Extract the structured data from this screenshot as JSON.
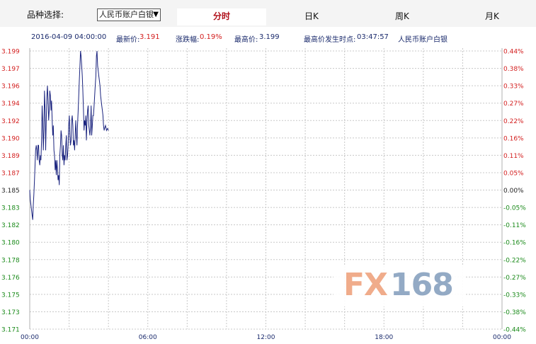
{
  "header": {
    "selector_label": "品种选择:",
    "selected_product": "人民币账户白银",
    "tabs": [
      "分时",
      "日K",
      "周K",
      "月K"
    ],
    "active_tab": "分时"
  },
  "info": {
    "datetime": "2016-04-09 04:00:00",
    "latest_label": "最新价:",
    "latest_value": "3.191",
    "change_label": "涨跌幅:",
    "change_value": "0.19%",
    "high_label": "最高价:",
    "high_value": "3.199",
    "high_time_label": "最高价发生时点:",
    "high_time_value": "03:47:57",
    "product_name": "人民币账户白银"
  },
  "watermark": {
    "part1": "FX",
    "part2": "168"
  },
  "colors": {
    "up": "#d31e1e",
    "down": "#1a8a1a",
    "neutral": "#222222",
    "line": "#1a237e",
    "time": "#1a2a6c"
  },
  "chart_data": {
    "type": "line",
    "y_left_ticks": [
      "3.199",
      "3.197",
      "3.196",
      "3.194",
      "3.192",
      "3.190",
      "3.189",
      "3.187",
      "3.185",
      "3.183",
      "3.182",
      "3.180",
      "3.178",
      "3.176",
      "3.175",
      "3.173",
      "3.171"
    ],
    "y_right_ticks": [
      "0.44%",
      "0.38%",
      "0.33%",
      "0.27%",
      "0.22%",
      "0.16%",
      "0.11%",
      "0.05%",
      "0.00%",
      "-0.05%",
      "-0.11%",
      "-0.16%",
      "-0.22%",
      "-0.27%",
      "-0.33%",
      "-0.38%",
      "-0.44%"
    ],
    "x_ticks": [
      "00:00",
      "06:00",
      "12:00",
      "18:00",
      "00:00"
    ],
    "ylim": [
      3.171,
      3.199
    ],
    "xlim_hours": [
      0,
      24
    ],
    "reference_price": 3.185,
    "series": [
      {
        "x": [
          0,
          0.03,
          0.06,
          0.09,
          0.12,
          0.15,
          0.18,
          0.21,
          0.24,
          0.27,
          0.3,
          0.33,
          0.36,
          0.39,
          0.42,
          0.45,
          0.48,
          0.51,
          0.54,
          0.57,
          0.6,
          0.63,
          0.66,
          0.69,
          0.72,
          0.75,
          0.78,
          0.81,
          0.84,
          0.87,
          0.9,
          0.93,
          0.96,
          0.99,
          1.02,
          1.05,
          1.08,
          1.11,
          1.14,
          1.17,
          1.2,
          1.23,
          1.26,
          1.29,
          1.32,
          1.35,
          1.38,
          1.41,
          1.44,
          1.47,
          1.5,
          1.53,
          1.56,
          1.59,
          1.62,
          1.65,
          1.68,
          1.71,
          1.74,
          1.77,
          1.8,
          1.83,
          1.86,
          1.89,
          1.92,
          1.95,
          1.98,
          2.01,
          2.04,
          2.07,
          2.1,
          2.13,
          2.16,
          2.19,
          2.22,
          2.25,
          2.28,
          2.31,
          2.34,
          2.37,
          2.4,
          2.43,
          2.46,
          2.49,
          2.52,
          2.55,
          2.58,
          2.61,
          2.64,
          2.67,
          2.7,
          2.73,
          2.76,
          2.79,
          2.82,
          2.85,
          2.88,
          2.91,
          2.94,
          2.97,
          3.0,
          3.03,
          3.06,
          3.09,
          3.12,
          3.15,
          3.18,
          3.21,
          3.24,
          3.27,
          3.3,
          3.33,
          3.36,
          3.39,
          3.42,
          3.45,
          3.48,
          3.51,
          3.54,
          3.57,
          3.6,
          3.63,
          3.66,
          3.69,
          3.72,
          3.75,
          3.78,
          3.8,
          3.85,
          3.9,
          3.95,
          4.0
        ],
        "y": [
          3.185,
          3.184,
          3.1835,
          3.183,
          3.1825,
          3.182,
          3.1835,
          3.1845,
          3.186,
          3.1875,
          3.189,
          3.1895,
          3.189,
          3.188,
          3.1895,
          3.1895,
          3.188,
          3.1875,
          3.1885,
          3.188,
          3.19,
          3.1935,
          3.192,
          3.189,
          3.191,
          3.195,
          3.193,
          3.189,
          3.192,
          3.1945,
          3.1955,
          3.194,
          3.192,
          3.193,
          3.195,
          3.1945,
          3.193,
          3.194,
          3.192,
          3.1905,
          3.1915,
          3.189,
          3.1885,
          3.187,
          3.188,
          3.1865,
          3.188,
          3.187,
          3.186,
          3.1865,
          3.1855,
          3.1885,
          3.1895,
          3.191,
          3.1905,
          3.1885,
          3.188,
          3.1895,
          3.1875,
          3.1885,
          3.188,
          3.1895,
          3.1905,
          3.188,
          3.1885,
          3.1895,
          3.1915,
          3.1925,
          3.1905,
          3.1895,
          3.19,
          3.192,
          3.1925,
          3.1915,
          3.1895,
          3.19,
          3.189,
          3.1905,
          3.192,
          3.1905,
          3.1895,
          3.1915,
          3.193,
          3.1945,
          3.196,
          3.1975,
          3.199,
          3.1985,
          3.1975,
          3.1965,
          3.195,
          3.193,
          3.191,
          3.192,
          3.1915,
          3.1925,
          3.19,
          3.192,
          3.193,
          3.1935,
          3.1915,
          3.191,
          3.1905,
          3.1915,
          3.1935,
          3.1905,
          3.1915,
          3.1925,
          3.1925,
          3.1935,
          3.1945,
          3.1955,
          3.1965,
          3.1985,
          3.199,
          3.1975,
          3.197,
          3.1965,
          3.196,
          3.1955,
          3.1945,
          3.194,
          3.1935,
          3.193,
          3.1925,
          3.1915,
          3.191,
          3.1912,
          3.1915,
          3.191,
          3.1912,
          3.191
        ]
      }
    ]
  }
}
